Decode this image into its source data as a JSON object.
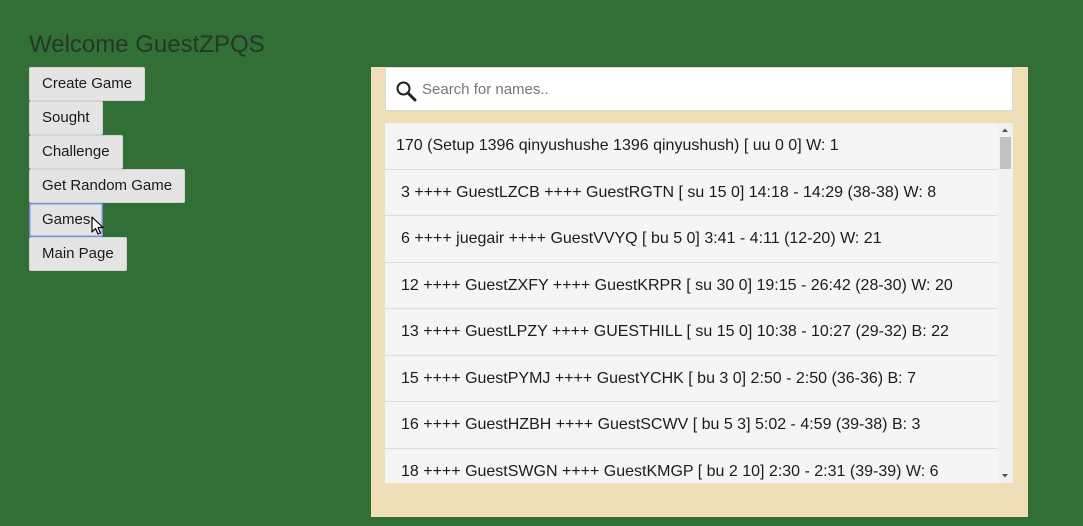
{
  "header": {
    "welcome": "Welcome GuestZPQS"
  },
  "menu": {
    "create_game": "Create Game",
    "sought": "Sought",
    "challenge": "Challenge",
    "get_random_game": "Get Random Game",
    "games": "Games",
    "main_page": "Main Page"
  },
  "search": {
    "placeholder": "Search for names..",
    "value": ""
  },
  "games": [
    "170 (Setup 1396 qinyushushe 1396 qinyushush) [ uu 0 0] W: 1",
    "3 ++++ GuestLZCB ++++ GuestRGTN [ su 15 0] 14:18 - 14:29 (38-38) W: 8",
    "6 ++++ juegair ++++ GuestVVYQ [ bu 5 0] 3:41 - 4:11 (12-20) W: 21",
    "12 ++++ GuestZXFY ++++ GuestKRPR [ su 30 0] 19:15 - 26:42 (28-30) W: 20",
    "13 ++++ GuestLPZY ++++ GUESTHILL [ su 15 0] 10:38 - 10:27 (29-32) B: 22",
    "15 ++++ GuestPYMJ ++++ GuestYCHK [ bu 3 0] 2:50 - 2:50 (36-36) B: 7",
    "16 ++++ GuestHZBH ++++ GuestSCWV [ bu 5 3] 5:02 - 4:59 (39-38) B: 3",
    "18 ++++ GuestSWGN ++++ GuestKMGP [ bu 2 10] 2:30 - 2:31 (39-39) W: 6"
  ],
  "colors": {
    "background": "#316f37",
    "panel": "#efdeb8",
    "button": "#e4e4e4"
  },
  "icons": {
    "search": "magnifier-icon",
    "cursor": "mouse-pointer-icon"
  }
}
